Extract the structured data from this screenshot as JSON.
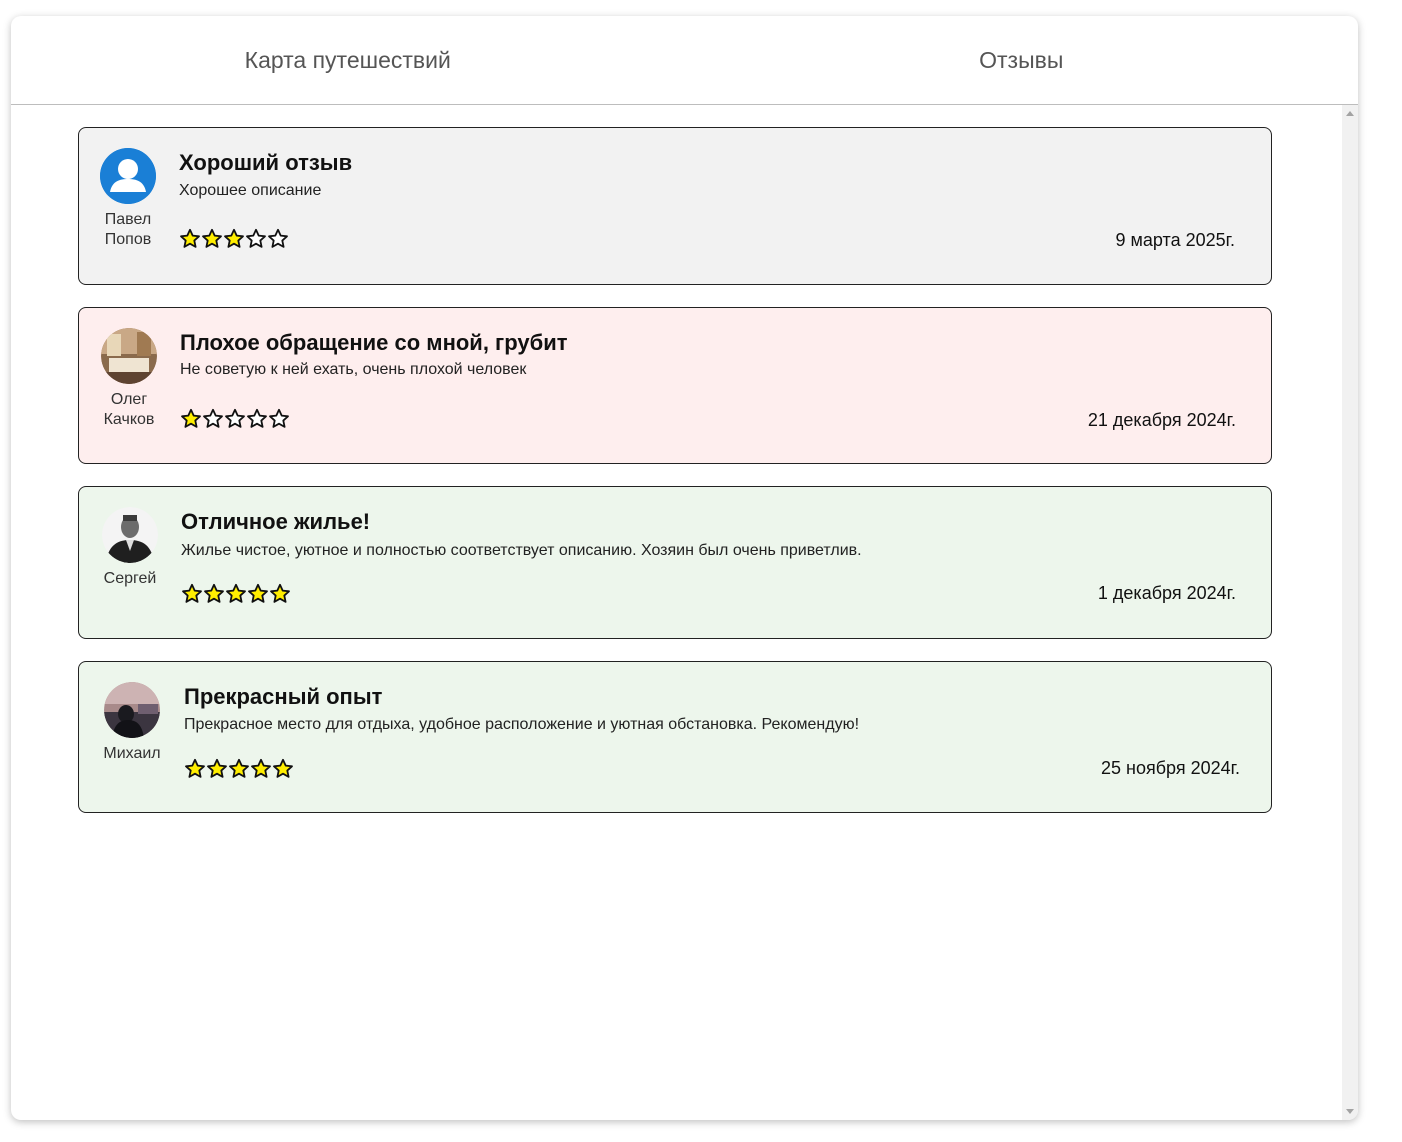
{
  "tabs": [
    {
      "label": "Карта путешествий"
    },
    {
      "label": "Отзывы"
    }
  ],
  "colors": {
    "neutral_bg": "#f2f2f2",
    "negative_bg": "#feeeee",
    "positive_bg": "#edf6ec",
    "star_fill": "#ffee00",
    "default_avatar": "#1a7fd6"
  },
  "reviews": [
    {
      "author_first": "Павел",
      "author_last": "Попов",
      "avatar": "default-user-icon",
      "title": "Хороший отзыв",
      "description": "Хорошее описание",
      "rating": 3,
      "max_rating": 5,
      "date": "9 марта 2025г.",
      "tone": "neutral"
    },
    {
      "author_first": "Олег",
      "author_last": "Качков",
      "avatar": "photo-hotel-room",
      "title": "Плохое обращение со мной, грубит",
      "description": "Не советую к ней ехать, очень плохой человек",
      "rating": 1,
      "max_rating": 5,
      "date": "21 декабря 2024г.",
      "tone": "negative"
    },
    {
      "author_first": "Сергей",
      "author_last": "",
      "avatar": "photo-man-uniform",
      "title": "Отличное жилье!",
      "description": "Жилье чистое, уютное и полностью соответствует описанию. Хозяин был очень приветлив.",
      "rating": 5,
      "max_rating": 5,
      "date": "1 декабря 2024г.",
      "tone": "positive"
    },
    {
      "author_first": "Михаил",
      "author_last": "",
      "avatar": "photo-person-sunset",
      "title": "Прекрасный опыт",
      "description": "Прекрасное место для отдыха, удобное расположение и уютная обстановка. Рекомендую!",
      "rating": 5,
      "max_rating": 5,
      "date": "25 ноября 2024г.",
      "tone": "positive"
    }
  ]
}
